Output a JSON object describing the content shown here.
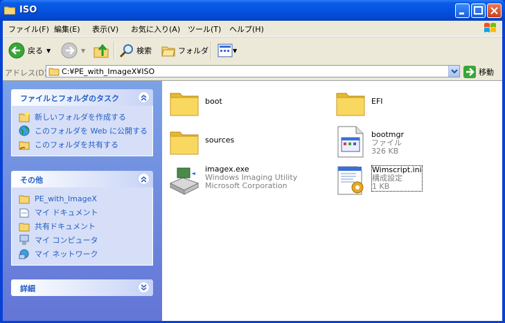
{
  "window": {
    "title": "ISO"
  },
  "menu": [
    "ファイル(F)",
    "編集(E)",
    "表示(V)",
    "お気に入り(A)",
    "ツール(T)",
    "ヘルプ(H)"
  ],
  "toolbar": {
    "back": "戻る",
    "search": "検索",
    "folders": "フォルダ"
  },
  "address": {
    "label": "アドレス(D)",
    "path": "C:¥PE_with_ImageX¥ISO",
    "go": "移動"
  },
  "tasks_panel": {
    "title": "ファイルとフォルダのタスク",
    "items": [
      "新しいフォルダを作成する",
      "このフォルダを Web に公開する",
      "このフォルダを共有する"
    ]
  },
  "other_panel": {
    "title": "その他",
    "items": [
      "PE_with_ImageX",
      "マイ ドキュメント",
      "共有ドキュメント",
      "マイ コンピュータ",
      "マイ ネットワーク"
    ]
  },
  "details_panel": {
    "title": "詳細"
  },
  "files": [
    {
      "name": "boot",
      "icon": "folder-icon"
    },
    {
      "name": "EFI",
      "icon": "folder-icon"
    },
    {
      "name": "sources",
      "icon": "folder-icon"
    },
    {
      "name": "bootmgr",
      "type": "ファイル",
      "size": "326 KB",
      "icon": "file-icon"
    },
    {
      "name": "imagex.exe",
      "type": "Windows Imaging Utility",
      "company": "Microsoft Corporation",
      "icon": "application-icon"
    },
    {
      "name": "Wimscript.ini",
      "type": "構成設定",
      "size": "1 KB",
      "icon": "settings-file-icon"
    }
  ],
  "colors": {
    "titlebar": "#0553e0",
    "taskpane": "#6375d6",
    "link": "#215dc6"
  }
}
